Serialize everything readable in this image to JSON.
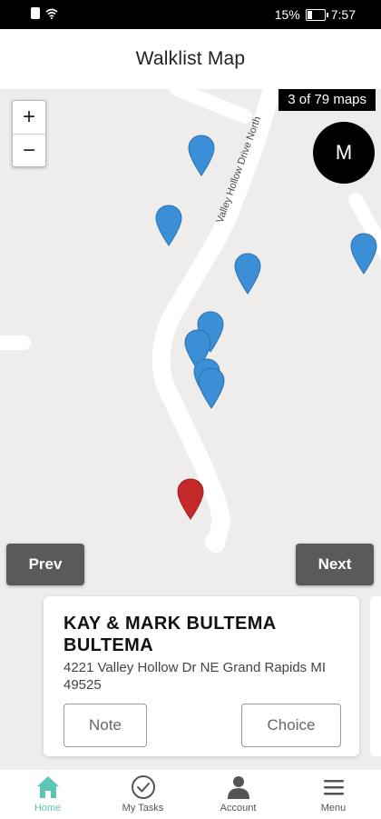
{
  "status_bar": {
    "battery": "15%",
    "time": "7:57"
  },
  "header": {
    "title": "Walklist Map"
  },
  "map": {
    "road_name": "Valley Hollow Drive North",
    "counter": "3 of 79 maps",
    "zoom_in": "+",
    "zoom_out": "−",
    "mode_label": "M",
    "prev_label": "Prev",
    "next_label": "Next",
    "pin_color_default": "#3a8fd6",
    "pin_color_selected": "#c42a2a"
  },
  "card": {
    "name": "KAY & MARK BULTEMA BULTEMA",
    "address": "4221 Valley Hollow Dr NE Grand Rapids MI 49525",
    "note_label": "Note",
    "choice_label": "Choice"
  },
  "bottom_nav": {
    "active_color": "#5fc4b4",
    "items": [
      {
        "label": "Home",
        "icon": "home-icon"
      },
      {
        "label": "My Tasks",
        "icon": "check-circle-icon"
      },
      {
        "label": "Account",
        "icon": "person-icon"
      },
      {
        "label": "Menu",
        "icon": "menu-icon"
      }
    ]
  }
}
